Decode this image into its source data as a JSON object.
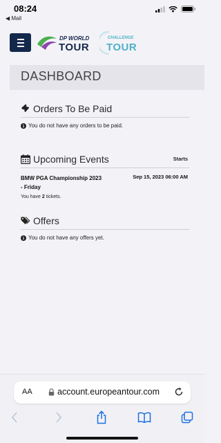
{
  "status_bar": {
    "time": "08:24",
    "back_app": "◀ Mail"
  },
  "logos": {
    "dp_world_top": "DP WORLD",
    "dp_world_bottom": "TOUR",
    "challenge_top": "CHALLENGE",
    "challenge_bottom": "TOUR"
  },
  "dashboard": {
    "title": "DASHBOARD"
  },
  "orders": {
    "title": "Orders To Be Paid",
    "empty_message": "You do not have any orders to be paid."
  },
  "events": {
    "title": "Upcoming Events",
    "starts_label": "Starts",
    "items": [
      {
        "name": "BMW PGA Championship 2023 - Friday",
        "date": "Sep 15, 2023 06:00 AM",
        "tickets_prefix": "You have ",
        "tickets_count": "2",
        "tickets_suffix": " tickets."
      }
    ]
  },
  "offers": {
    "title": "Offers",
    "empty_message": "You do not have any offers yet."
  },
  "browser": {
    "aa_label": "AA",
    "url": "account.europeantour.com"
  },
  "colors": {
    "brand_navy": "#14284b",
    "challenge_teal": "#4fb0c8",
    "dp_world_green": "#4caf50"
  }
}
